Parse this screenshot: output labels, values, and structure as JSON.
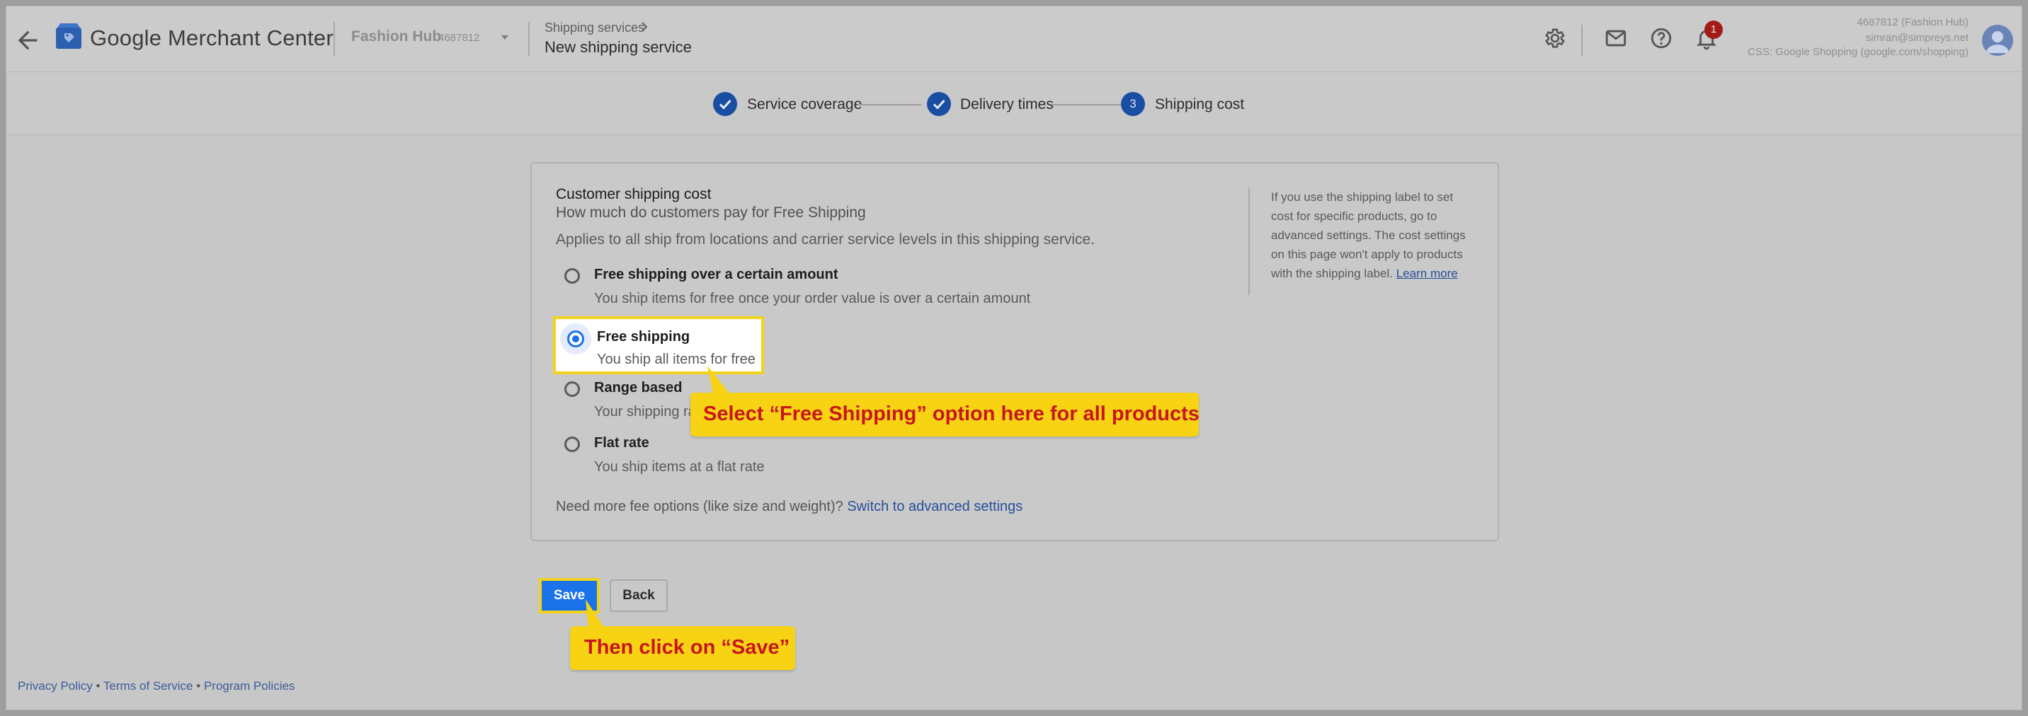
{
  "header": {
    "brand_google": "Google",
    "brand_product": "Merchant Center",
    "account_name": "Fashion Hub",
    "account_id": "4687812",
    "breadcrumb_parent": "Shipping services",
    "page_title": "New shipping service",
    "notification_count": "1",
    "user_line1": "4687812 (Fashion Hub)",
    "user_line2": "simran@simpreys.net",
    "user_line3": "CSS: Google Shopping (google.com/shopping)"
  },
  "stepper": {
    "steps": [
      {
        "label": "Service coverage",
        "state": "done"
      },
      {
        "label": "Delivery times",
        "state": "done"
      },
      {
        "label": "Shipping cost",
        "number": "3",
        "state": "current"
      }
    ]
  },
  "card": {
    "title": "Customer shipping cost",
    "subtitle": "How much do customers pay for Free Shipping",
    "applies": "Applies to all ship from locations and carrier service levels in this shipping service.",
    "options": [
      {
        "title": "Free shipping over a certain amount",
        "desc": "You ship items for free once your order value is over a certain amount"
      },
      {
        "title": "Free shipping",
        "desc": "You ship all items for free",
        "selected": true
      },
      {
        "title": "Range based",
        "desc": "Your shipping rate"
      },
      {
        "title": "Flat rate",
        "desc": "You ship items at a flat rate"
      }
    ],
    "foot_text": "Need more fee options (like size and weight)?",
    "foot_link": "Switch to advanced settings",
    "side_note": "If you use the shipping label to set cost for specific products, go to advanced settings. The cost settings on this page won't apply to products with the shipping label.",
    "side_link": "Learn more"
  },
  "callouts": {
    "free_shipping": "Select “Free Shipping” option here for all products",
    "save": "Then click on “Save”"
  },
  "buttons": {
    "save": "Save",
    "back": "Back"
  },
  "footer": {
    "privacy": "Privacy Policy",
    "terms": "Terms of Service",
    "programs": "Program Policies",
    "separator": "•"
  },
  "colors": {
    "accent": "#1a73e8",
    "highlight": "#f2d21b",
    "callout_text": "#c8161b"
  }
}
